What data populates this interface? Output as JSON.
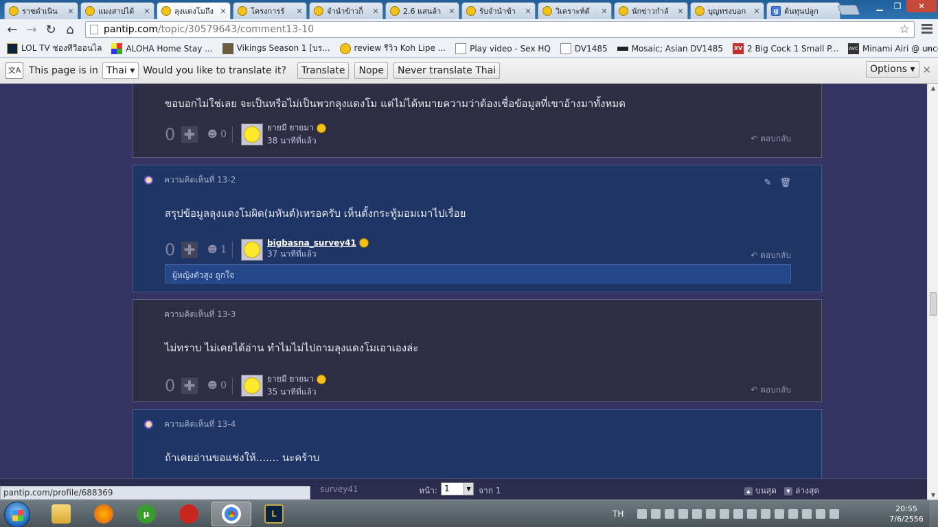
{
  "tabs": [
    {
      "title": "ราชดำเนิน",
      "icon": "pantip-favicon"
    },
    {
      "title": "แมงสาปได้",
      "icon": "pantip-favicon"
    },
    {
      "title": "ลุงแดงโมถึง",
      "icon": "pantip-favicon",
      "active": true
    },
    {
      "title": "โครงการรั",
      "icon": "pantip-favicon"
    },
    {
      "title": "จำนำข้าวก็",
      "icon": "pantip-favicon"
    },
    {
      "title": "2.6 แสนล้า",
      "icon": "pantip-favicon"
    },
    {
      "title": "รับจำนำข้า",
      "icon": "pantip-favicon"
    },
    {
      "title": "วิเคราะห์ตั",
      "icon": "pantip-favicon"
    },
    {
      "title": "นักข่าวกำลั",
      "icon": "pantip-favicon"
    },
    {
      "title": "บุญทรงบอก",
      "icon": "pantip-favicon"
    },
    {
      "title": "ต้นทุนปลูก",
      "icon": "google-favicon"
    }
  ],
  "address": {
    "host": "pantip.com",
    "path": "/topic/30579643/comment13-10"
  },
  "bookmarks": [
    {
      "label": "LOL TV ช่องทีวีออนไล",
      "icon": "lol-icon"
    },
    {
      "label": "ALOHA Home Stay ...",
      "icon": "aloha-icon"
    },
    {
      "label": "Vikings Season 1 [บร...",
      "icon": "vikings-icon"
    },
    {
      "label": "review รีวิว Koh Lipe ...",
      "icon": "pantip-favicon"
    },
    {
      "label": "Play video - Sex HQ",
      "icon": "page-icon"
    },
    {
      "label": "DV1485",
      "icon": "page-icon"
    },
    {
      "label": "Mosaic; Asian DV1485",
      "icon": "mosaic-icon"
    },
    {
      "label": "2 Big Cock 1 Small P...",
      "icon": "xv-icon"
    },
    {
      "label": "Minami Airi @ unce...",
      "icon": "avc-icon"
    }
  ],
  "translate": {
    "prefix": "This page is in",
    "language": "Thai",
    "question": "Would you like to translate it?",
    "translate_label": "Translate",
    "nope_label": "Nope",
    "never_label": "Never translate Thai",
    "options_label": "Options"
  },
  "comments": [
    {
      "header": "",
      "body": "ขอบอกไม่ใช่เลย จะเป็นหรือไม่เป็นพวกลุงแดงโม แต่ไม่ได้หมายความว่าต้องเชื่อข้อมูลที่เขาอ้างมาทั้งหมด",
      "votes": "0",
      "emotions": "0",
      "author": "ยายมี ยายมา",
      "time": "38 นาทีที่แล้ว",
      "reply": "ตอบกลับ"
    },
    {
      "header": "ความคิดเห็นที่ 13-2",
      "body": "สรุปข้อมูลลุงแดงโมผิด(มหันต์)เหรอครับ เห็นตั้งกระทู้มอมเมาไปเรื่อย",
      "votes": "0",
      "emotions": "1",
      "author": "bigbasna_survey41",
      "time": "37 นาทีที่แล้ว",
      "reply": "ตอบกลับ",
      "subreply": "ผู้หญิงตัวสูง ถูกใจ"
    },
    {
      "header": "ความคิดเห็นที่ 13-3",
      "body": "ไม่ทราบ ไม่เคยได้อ่าน ทำไมไม่ไปถามลุงแดงโมเอาเองล่ะ",
      "votes": "0",
      "emotions": "0",
      "author": "ยายมี ยายมา",
      "time": "35 นาทีที่แล้ว",
      "reply": "ตอบกลับ"
    },
    {
      "header": "ความคิดเห็นที่ 13-4",
      "body": "ถ้าเคยอ่านขอแช่งให้....... นะคร้าบ"
    }
  ],
  "pager": {
    "label": "หน้า:",
    "current": "1",
    "of": "จาก 1",
    "top": "บนสุด",
    "bottom": "ล่างสุด"
  },
  "status_url": "pantip.com/profile/688369",
  "peek_author": "survey41",
  "taskbar": {
    "lang": "TH",
    "time": "20:55",
    "date": "7/6/2556"
  }
}
